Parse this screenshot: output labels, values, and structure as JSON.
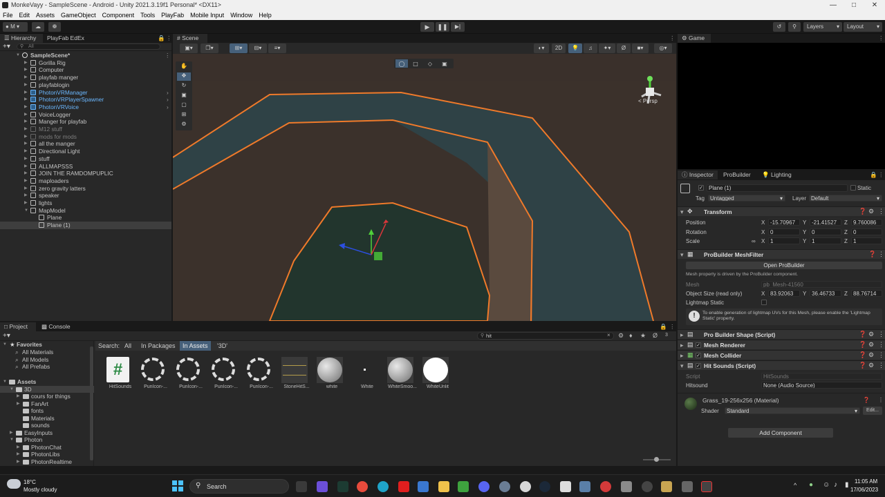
{
  "window": {
    "title": "MonkeVayy - SampleScene - Android - Unity 2021.3.19f1 Personal* <DX11>"
  },
  "menu": [
    "File",
    "Edit",
    "Assets",
    "GameObject",
    "Component",
    "Tools",
    "PlayFab",
    "Mobile Input",
    "Window",
    "Help"
  ],
  "toolbar": {
    "account": "M",
    "layers": "Layers",
    "layout": "Layout"
  },
  "hierarchy": {
    "tabs": [
      "Hierarchy",
      "PlayFab EdEx"
    ],
    "search_placeholder": "All",
    "items": [
      {
        "label": "SampleScene*",
        "depth": 0,
        "type": "scene"
      },
      {
        "label": "Gorilla Rig",
        "depth": 1,
        "type": "normal"
      },
      {
        "label": "Computer",
        "depth": 1,
        "type": "normal"
      },
      {
        "label": "playfab manger",
        "depth": 1,
        "type": "normal"
      },
      {
        "label": "playfablogin",
        "depth": 1,
        "type": "normal"
      },
      {
        "label": "PhotonVRManager",
        "depth": 1,
        "type": "prefab"
      },
      {
        "label": "PhotonVRPlayerSpawner",
        "depth": 1,
        "type": "prefab"
      },
      {
        "label": "PhotonVRVoice",
        "depth": 1,
        "type": "prefab"
      },
      {
        "label": "VoiceLogger",
        "depth": 1,
        "type": "normal"
      },
      {
        "label": "Manger for playfab",
        "depth": 1,
        "type": "normal"
      },
      {
        "label": "M12 stuff",
        "depth": 1,
        "type": "disabled"
      },
      {
        "label": "mods for mods",
        "depth": 1,
        "type": "disabled"
      },
      {
        "label": "all the manger",
        "depth": 1,
        "type": "normal"
      },
      {
        "label": "Directional Light",
        "depth": 1,
        "type": "normal"
      },
      {
        "label": "stuff",
        "depth": 1,
        "type": "normal"
      },
      {
        "label": "ALLMAPSSS",
        "depth": 1,
        "type": "normal"
      },
      {
        "label": "JOIN THE RAMDOMPUPLIC",
        "depth": 1,
        "type": "normal"
      },
      {
        "label": "maploaders",
        "depth": 1,
        "type": "normal"
      },
      {
        "label": "zero gravity latters",
        "depth": 1,
        "type": "normal"
      },
      {
        "label": "speaker",
        "depth": 1,
        "type": "normal"
      },
      {
        "label": "lights",
        "depth": 1,
        "type": "normal"
      },
      {
        "label": "MapModel",
        "depth": 1,
        "type": "normal"
      },
      {
        "label": "Plane",
        "depth": 2,
        "type": "normal"
      },
      {
        "label": "Plane (1)",
        "depth": 2,
        "type": "selected"
      }
    ]
  },
  "scene": {
    "tab": "Scene",
    "mode_2d": "2D",
    "persp": "< Persp"
  },
  "game": {
    "tab": "Game"
  },
  "inspector": {
    "tabs": [
      "Inspector",
      "ProBuilder",
      "Lighting"
    ],
    "object_name": "Plane (1)",
    "static_label": "Static",
    "tag_label": "Tag",
    "tag_value": "Untagged",
    "layer_label": "Layer",
    "layer_value": "Default",
    "transform": {
      "title": "Transform",
      "position": {
        "label": "Position",
        "x": "-15.70967",
        "y": "-21.41527",
        "z": "9.760086"
      },
      "rotation": {
        "label": "Rotation",
        "x": "0",
        "y": "0",
        "z": "0"
      },
      "scale": {
        "label": "Scale",
        "x": "1",
        "y": "1",
        "z": "1"
      }
    },
    "meshfilter": {
      "title": "ProBuilder MeshFilter",
      "open_button": "Open ProBuilder",
      "note": "Mesh property is driven by the ProBuilder component.",
      "mesh_label": "Mesh",
      "mesh_value": "pb_Mesh-41560",
      "size_label": "Object Size (read only)",
      "size_x": "83.92063",
      "size_y": "36.46733",
      "size_z": "88.76714",
      "lightmap_label": "Lightmap Static",
      "info": "To enable generation of lightmap UVs for this Mesh, please enable the 'Lightmap Static' property."
    },
    "components": [
      "Pro Builder Shape (Script)",
      "Mesh Renderer",
      "Mesh Collider",
      "Hit Sounds (Script)"
    ],
    "script_label": "Script",
    "script_value": "HitSounds",
    "hitsound_label": "Hitsound",
    "hitsound_value": "None (Audio Source)",
    "material_title": "Grass_19-256x256 (Material)",
    "shader_label": "Shader",
    "shader_value": "Standard",
    "edit_button": "Edit...",
    "add_component": "Add Component"
  },
  "project": {
    "tabs": [
      "Project",
      "Console"
    ],
    "search_value": "hit",
    "search_label": "Search:",
    "search_scopes": [
      "All",
      "In Packages",
      "In Assets",
      "'3D'"
    ],
    "badge": "3",
    "favorites": {
      "title": "Favorites",
      "items": [
        "All Materials",
        "All Models",
        "All Prefabs"
      ]
    },
    "assets_tree": [
      {
        "label": "Assets",
        "depth": 0
      },
      {
        "label": "3D",
        "depth": 1
      },
      {
        "label": "cours for things",
        "depth": 2
      },
      {
        "label": "FanArt",
        "depth": 2
      },
      {
        "label": "fonts",
        "depth": 2
      },
      {
        "label": "Materials",
        "depth": 2
      },
      {
        "label": "sounds",
        "depth": 2
      },
      {
        "label": "EasyInputs",
        "depth": 1
      },
      {
        "label": "Photon",
        "depth": 1
      },
      {
        "label": "PhotonChat",
        "depth": 2
      },
      {
        "label": "PhotonLibs",
        "depth": 2
      },
      {
        "label": "PhotonRealtime",
        "depth": 2
      }
    ],
    "assets": [
      {
        "label": "HitSounds",
        "kind": "script"
      },
      {
        "label": "PunIcon-...",
        "kind": "pun"
      },
      {
        "label": "PunIcon-...",
        "kind": "pun"
      },
      {
        "label": "PunIcon-...",
        "kind": "pun"
      },
      {
        "label": "PunIcon-...",
        "kind": "pun"
      },
      {
        "label": "StoneHitS...",
        "kind": "audio"
      },
      {
        "label": "white",
        "kind": "sphere"
      },
      {
        "label": "White",
        "kind": "dot"
      },
      {
        "label": "WhiteSmoo...",
        "kind": "sphere"
      },
      {
        "label": "WhiteUnlit",
        "kind": "white"
      }
    ]
  },
  "taskbar": {
    "weather_temp": "18°C",
    "weather_desc": "Mostly cloudy",
    "search": "Search",
    "time": "11:05 AM",
    "date": "17/06/2023"
  },
  "colors": {
    "accent": "#2c5d87",
    "outline": "#f07a2a",
    "prefab": "#6bb8ff"
  }
}
